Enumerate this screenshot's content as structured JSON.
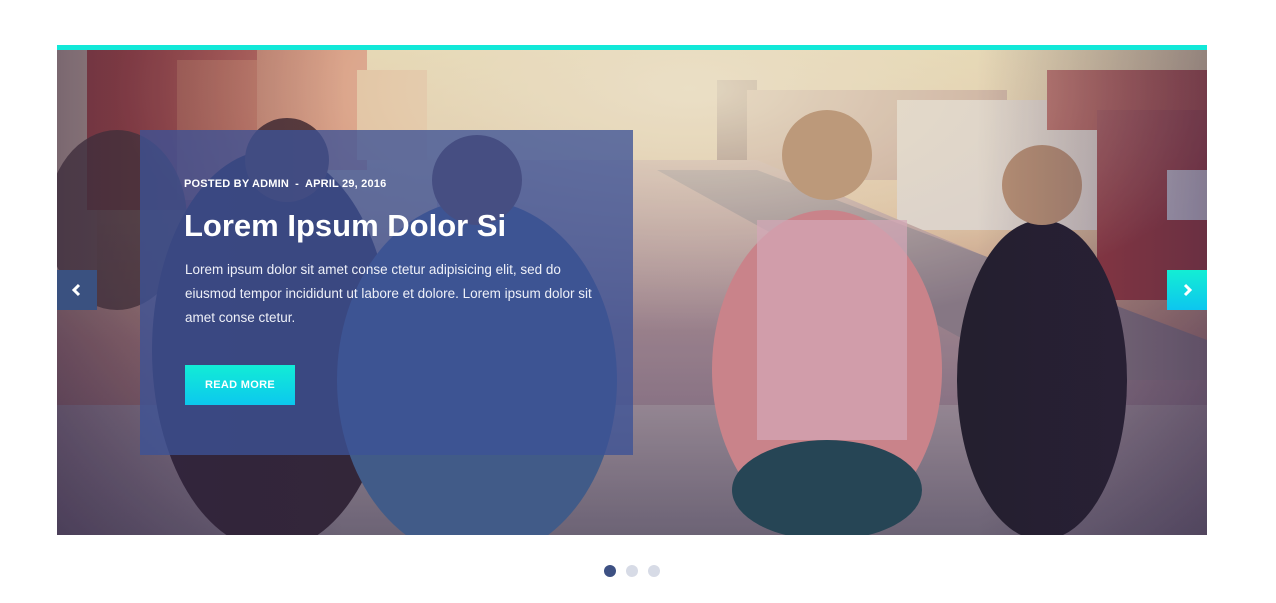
{
  "slider": {
    "slide": {
      "meta": {
        "author_prefix": "POSTED BY ADMIN",
        "separator": "-",
        "date": "APRIL 29, 2016"
      },
      "title": "Lorem Ipsum Dolor Si",
      "excerpt": "Lorem ipsum dolor sit amet conse ctetur adipisicing elit, sed do eiusmod tempor incididunt ut labore et dolore. Lorem ipsum dolor sit amet conse ctetur.",
      "button_label": "READ MORE"
    },
    "prev_icon": "chevron-left-icon",
    "next_icon": "chevron-right-icon",
    "dots": {
      "count": 3,
      "active_index": 0
    }
  },
  "colors": {
    "accent": "#12e8d8",
    "caption_bg": "#3c5296",
    "dot_active": "#3d5183",
    "dot_inactive": "#d7dbe6"
  }
}
